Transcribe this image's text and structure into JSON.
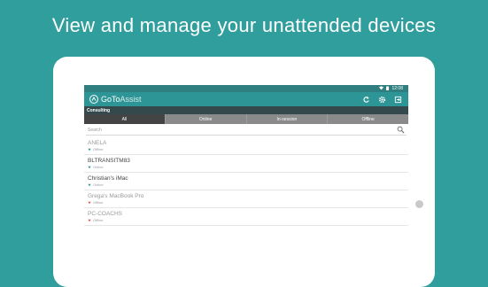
{
  "headline": "View and manage your unattended devices",
  "status_bar": {
    "time": "12:08"
  },
  "app": {
    "logo_part1": "GoTo",
    "logo_part2": "Assist",
    "toolbar_icons": [
      "refresh-icon",
      "gear-icon",
      "logout-icon"
    ]
  },
  "group": {
    "name": "Consulting"
  },
  "tabs": [
    {
      "label": "All",
      "active": true
    },
    {
      "label": "Online",
      "active": false
    },
    {
      "label": "In-session",
      "active": false
    },
    {
      "label": "Offline",
      "active": false
    }
  ],
  "search": {
    "placeholder": "Search"
  },
  "devices": [
    {
      "name": "ANELA",
      "status": "Offline",
      "online": false,
      "arrow_color": "#2e9596"
    },
    {
      "name": "BLTRANSITM83",
      "status": "Online",
      "online": true,
      "arrow_color": "#2e9596"
    },
    {
      "name": "Christian's iMac",
      "status": "Online",
      "online": true,
      "arrow_color": "#2e9596"
    },
    {
      "name": "Grega's MacBook Pro",
      "status": "Offline",
      "online": false,
      "arrow_color": "#d9534f"
    },
    {
      "name": "PC-COACHS",
      "status": "Offline",
      "online": false,
      "arrow_color": "#d9534f"
    }
  ],
  "colors": {
    "background": "#2f9e9c",
    "app_bar": "#2e9596",
    "tab_active": "#444444",
    "tab_inactive": "#8a8a8a"
  }
}
